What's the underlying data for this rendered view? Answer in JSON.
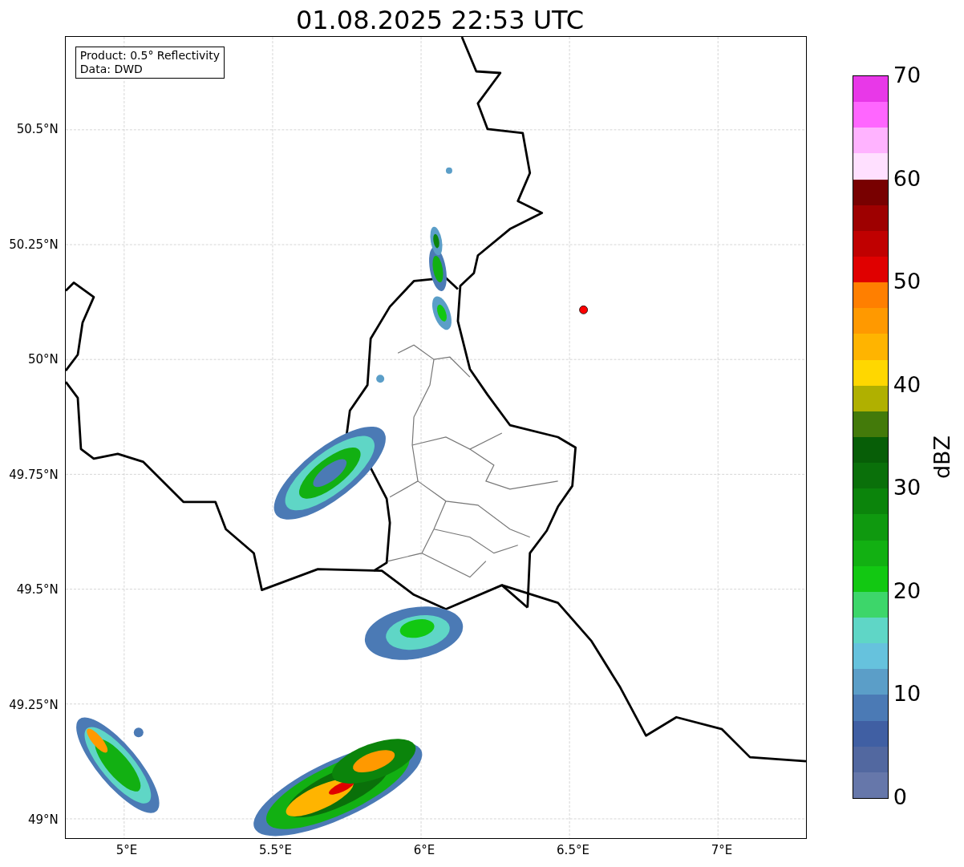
{
  "title": "01.08.2025 22:53 UTC",
  "legend": {
    "lines": [
      "Product: 0.5° Reflectivity",
      "Data: DWD"
    ]
  },
  "map": {
    "y_ticks": [
      "50.5°N",
      "50.25°N",
      "50°N",
      "49.75°N",
      "49.5°N",
      "49.25°N",
      "49°N"
    ],
    "x_ticks": [
      "5°E",
      "5.5°E",
      "6°E",
      "6.5°E",
      "7°E"
    ]
  },
  "colorbar": {
    "label": "dBZ",
    "ticks": [
      "70",
      "60",
      "50",
      "40",
      "30",
      "20",
      "10",
      "0"
    ],
    "segments": [
      {
        "color": "#e838e8"
      },
      {
        "color": "#ff66ff"
      },
      {
        "color": "#ffb3ff"
      },
      {
        "color": "#ffe0ff"
      },
      {
        "color": "#780000"
      },
      {
        "color": "#9e0000"
      },
      {
        "color": "#c00000"
      },
      {
        "color": "#e00000"
      },
      {
        "color": "#ff7f00"
      },
      {
        "color": "#ff9900"
      },
      {
        "color": "#ffb400"
      },
      {
        "color": "#ffd700"
      },
      {
        "color": "#b0b000"
      },
      {
        "color": "#437a0a"
      },
      {
        "color": "#075e07"
      },
      {
        "color": "#0a700a"
      },
      {
        "color": "#0b840b"
      },
      {
        "color": "#0f990f"
      },
      {
        "color": "#12b012"
      },
      {
        "color": "#12c812"
      },
      {
        "color": "#3dd66a"
      },
      {
        "color": "#5fd6c6"
      },
      {
        "color": "#66c2dd"
      },
      {
        "color": "#5b9ec8"
      },
      {
        "color": "#4b7ab5"
      },
      {
        "color": "#405fa3"
      },
      {
        "color": "#5268a0"
      },
      {
        "color": "#6677aa"
      }
    ]
  }
}
